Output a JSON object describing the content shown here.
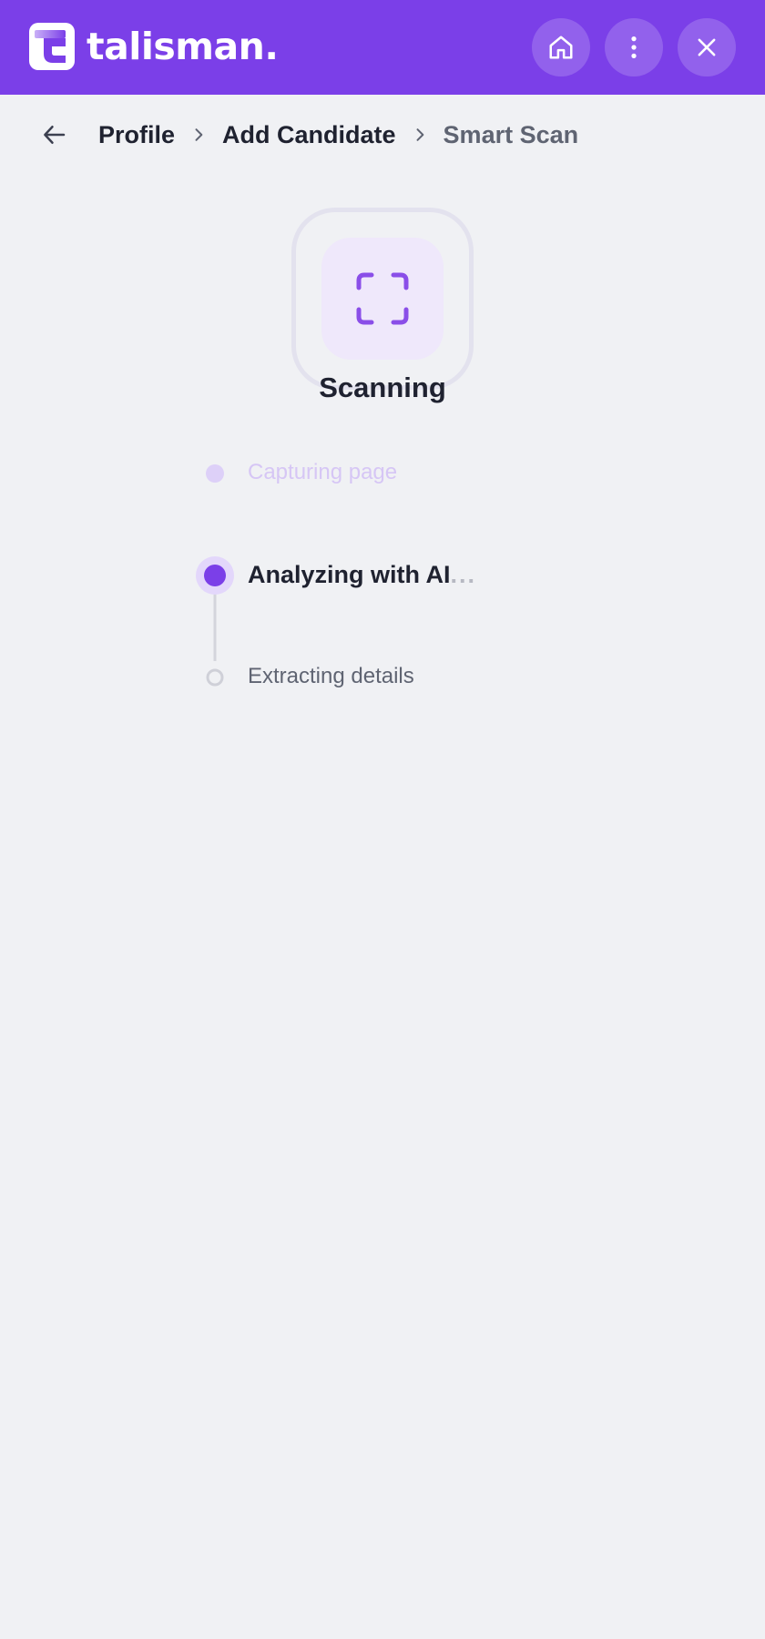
{
  "app": {
    "brand_name": "talisman.",
    "accent_color": "#7b3fe8"
  },
  "header": {
    "buttons": [
      {
        "name": "home",
        "icon": "home-icon"
      },
      {
        "name": "more",
        "icon": "vertical-dots-icon"
      },
      {
        "name": "close",
        "icon": "close-icon"
      }
    ]
  },
  "breadcrumb": {
    "back_icon": "arrow-left-icon",
    "items": [
      "Profile",
      "Add Candidate",
      "Smart Scan"
    ]
  },
  "scan": {
    "icon": "scan-frame-icon",
    "title": "Scanning"
  },
  "steps": [
    {
      "label": "Capturing page",
      "state": "done"
    },
    {
      "label": "Analyzing with AI",
      "suffix": "...",
      "state": "active"
    },
    {
      "label": "Extracting details",
      "state": "pending"
    }
  ]
}
